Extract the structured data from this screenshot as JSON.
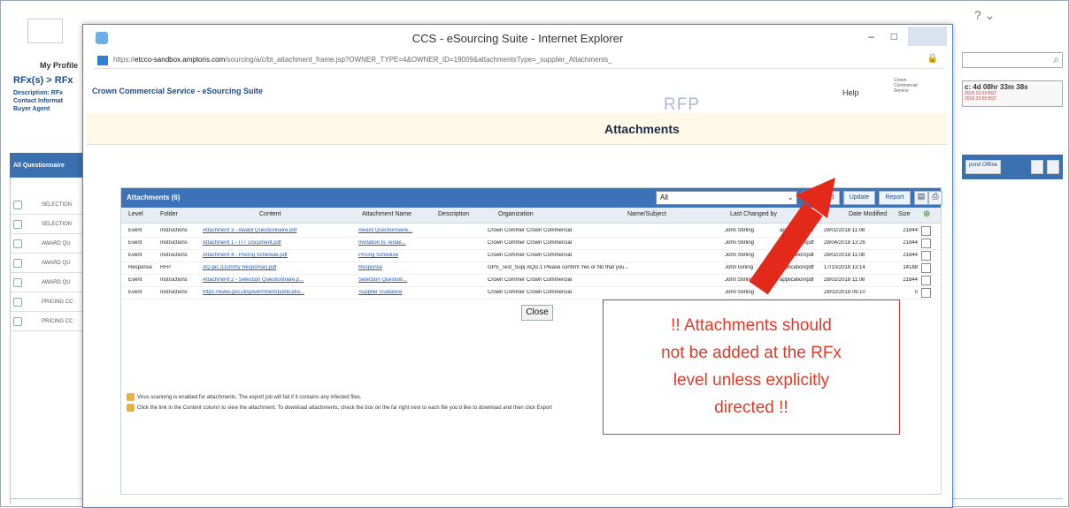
{
  "background": {
    "profile_link": "My Profile",
    "rfx_breadcrumb": "RFx(s) > RFx",
    "description_lines": [
      "Description: RFx",
      "Contact Informat",
      "Buyer Agent"
    ],
    "tab_label": "All Questionnaire",
    "rows": [
      "SELECTION",
      "SELECTION",
      "AWARD QU",
      "AWARD QU",
      "AWARD QU",
      "PRICING CC",
      "PRICING CC"
    ],
    "timer": "c: 4d 08hr 33m 38s",
    "timer_sub1": "2018 13:23 BST",
    "timer_sub2": "2018 23:59 BST",
    "right_button": "pond Offline",
    "help_icon": "? ⌄"
  },
  "window": {
    "title": "CCS - eSourcing Suite - Internet Explorer",
    "url_prefix": "https://",
    "url_host": "etcco-sandbox.amptoris.com",
    "url_path": "/sourcing/a/c/bt_attachment_frame.jsp?OWNER_TYPE=4&OWNER_ID=19009&attachmentsType=_supplier_Attachments_",
    "minimize": "–",
    "maximize": "□"
  },
  "page": {
    "site_title": "Crown Commercial Service - eSourcing Suite",
    "help": "Help",
    "logo_text": "Crown Commercial Service",
    "rfp_mark": "RFP",
    "heading": "Attachments"
  },
  "panel": {
    "title": "Attachments (6)",
    "filter_value": "All",
    "buttons": {
      "add": "Add",
      "update": "Update",
      "report": "Report"
    },
    "columns": [
      "Level",
      "Folder",
      "Content",
      "Attachment Name",
      "Description",
      "Organization",
      "Name/Subject",
      "Last Changed by",
      "",
      "Date Modified",
      "Size"
    ],
    "rows": [
      {
        "level": "Event",
        "folder": "Instructions",
        "content": "Attachment 3 - Award Questionnaire.pdf",
        "name": "Award Questionnaire...",
        "description": "",
        "org": "Crown Commercial",
        "subject": "Crown Commercial",
        "changed_by": "John Stirling",
        "type": "application/pdf",
        "date": "28/02/2018 11:08",
        "size": "21844"
      },
      {
        "level": "Event",
        "folder": "Instructions",
        "content": "Attachment 1 - ITT Document.pdf",
        "name": "Invitation to Tende...",
        "description": "",
        "org": "Crown Commercial",
        "subject": "Crown Commercial",
        "changed_by": "John Stirling",
        "type": "application/pdf",
        "date": "28/04/2018 13:26",
        "size": "21844"
      },
      {
        "level": "Event",
        "folder": "Instructions",
        "content": "Attachment 4 - Pricing Schedule.pdf",
        "name": "Pricing Schedule",
        "description": "",
        "org": "Crown Commercial",
        "subject": "Crown Commercial",
        "changed_by": "John Stirling",
        "type": "application/pdf",
        "date": "28/02/2018 11:08",
        "size": "21844"
      },
      {
        "level": "Response",
        "folder": "RFP",
        "content": "AQ-pic (Dummy Response).pdf",
        "name": "Response",
        "description": "",
        "org": "GPS_Test_Supplier_43",
        "subject": "AQG.1 Please confirm Yes or No that you...",
        "changed_by": "John Girling",
        "type": "application/pdf",
        "date": "17/10/2018 13:14",
        "size": "14188"
      },
      {
        "level": "Event",
        "folder": "Instructions",
        "content": "Attachment 2 - Selection Questionnaire.p...",
        "name": "Selection Question...",
        "description": "",
        "org": "Crown Commercial",
        "subject": "Crown Commercial",
        "changed_by": "John Stirling",
        "type": "application/pdf",
        "date": "28/02/2018 11:08",
        "size": "21844"
      },
      {
        "level": "Event",
        "folder": "Instructions",
        "content": "https://www.gov.uk/government/publicatio...",
        "name": "Supplier Guidance",
        "description": "",
        "org": "Crown Commercial",
        "subject": "Crown Commercial",
        "changed_by": "John Stirling",
        "type": "",
        "date": "28/02/2018 09:10",
        "size": "0"
      }
    ],
    "close": "Close",
    "notes": [
      "Virus scanning is enabled for attachments. The export job will fail if it contains any infected files.",
      "Click the link in the Content column to view the attachment. To download attachments, check the box on the far right next to each file you'd like to download and then click Export"
    ]
  },
  "annotation": {
    "lines": [
      "!! Attachments should",
      "not be added at the RFx",
      "level unless explicitly",
      "directed !!"
    ],
    "color": "#e23a2a"
  }
}
